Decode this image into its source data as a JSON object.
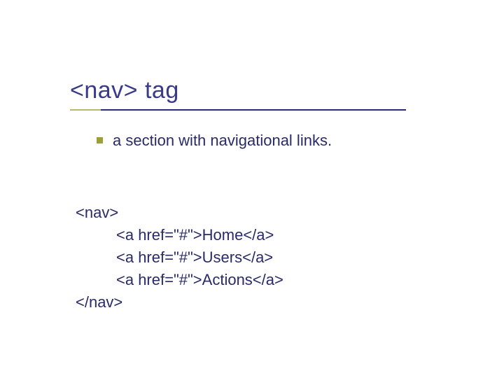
{
  "title": "<nav> tag",
  "bullet_text": "a section with navigational links.",
  "code": {
    "open": "<nav>",
    "line1": "<a href=\"#\">Home</a>",
    "line2": "<a href=\"#\">Users</a>",
    "line3": "<a href=\"#\">Actions</a>",
    "close": "</nav>"
  }
}
